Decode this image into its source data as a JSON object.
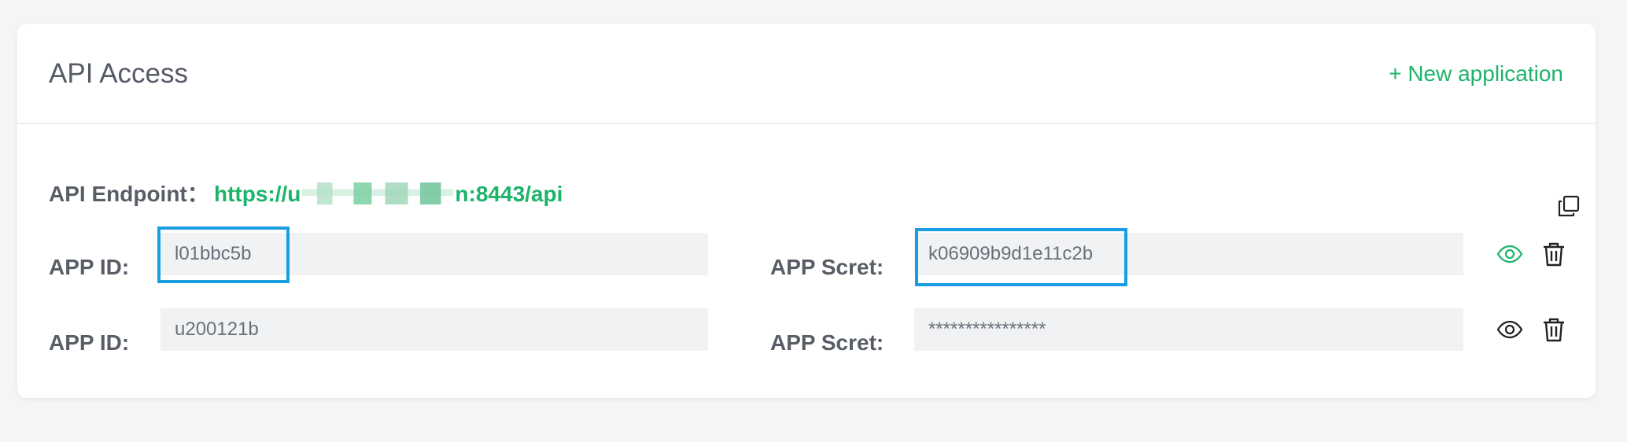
{
  "header": {
    "title": "API Access",
    "new_app_label": "+ New application"
  },
  "endpoint": {
    "label": "API Endpoint：",
    "url_prefix": "https://u",
    "url_suffix": "n:8443/api"
  },
  "apps": [
    {
      "id_label": "APP ID:",
      "id_value": "l01bbc5b",
      "secret_label": "APP Scret:",
      "secret_value": "k06909b9d1e11c2b",
      "visible": true
    },
    {
      "id_label": "APP ID:",
      "id_value": "u200121b",
      "secret_label": "APP Scret:",
      "secret_value": "****************",
      "visible": false
    }
  ],
  "colors": {
    "accent": "#1db46a",
    "highlight": "#1a9ee2",
    "label": "#585d66",
    "field_bg": "#f1f2f4"
  },
  "icons": {
    "copy": "copy-icon",
    "view": "eye-icon",
    "delete": "trash-icon"
  }
}
